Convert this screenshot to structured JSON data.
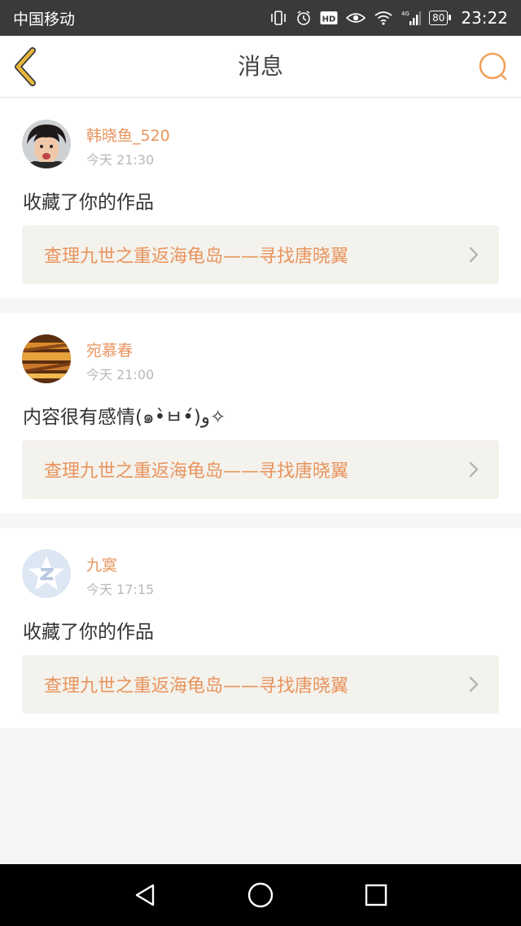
{
  "status_bar": {
    "carrier": "中国移动",
    "icons": [
      "vibrate-icon",
      "alarm-icon",
      "hd-icon",
      "eye-icon",
      "wifi-icon",
      "signal-4g-icon"
    ],
    "battery": "80",
    "time": "23:22"
  },
  "header": {
    "title": "消息",
    "back_icon": "chevron-left-icon",
    "search_icon": "search-icon",
    "accent_color": "#e8b73c",
    "search_color": "#f0a25a"
  },
  "messages": [
    {
      "username": "韩晓鱼_520",
      "time": "今天 21:30",
      "text": "收藏了你的作品",
      "work_title": "查理九世之重返海龟岛——寻找唐晓翼",
      "avatar": "person-photo"
    },
    {
      "username": "宛慕春",
      "time": "今天 21:00",
      "text": "内容很有感情(๑•̀ㅂ•́)و✧",
      "work_title": "查理九世之重返海龟岛——寻找唐晓翼",
      "avatar": "golden-photo"
    },
    {
      "username": "九寞",
      "time": "今天 17:15",
      "text": "收藏了你的作品",
      "work_title": "查理九世之重返海龟岛——寻找唐晓翼",
      "avatar": "default-star-z"
    }
  ],
  "nav_bar": {
    "back": "triangle-back-icon",
    "home": "circle-home-icon",
    "recent": "square-recent-icon"
  },
  "colors": {
    "username": "#e8945e",
    "link_bg": "#f4f2ec",
    "status_bg": "#3a3a3a"
  }
}
